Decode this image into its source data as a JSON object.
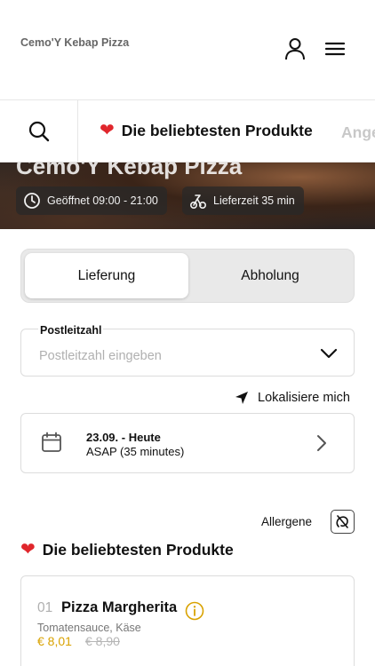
{
  "header": {
    "brand": "Cemo'Y Kebap Pizza",
    "user_icon": "user-icon",
    "menu_icon": "hamburger-menu-icon"
  },
  "category_bar": {
    "search_icon": "search-icon",
    "active_category": "Die beliebtesten Produkte",
    "next_category_partial": "Ange"
  },
  "hero": {
    "title": "Cemo'Y Kebap Pizza",
    "open_hours": "Geöffnet 09:00 - 21:00",
    "delivery_time": "Lieferzeit 35 min"
  },
  "order_mode": {
    "options": [
      "Lieferung",
      "Abholung"
    ],
    "selected": "Lieferung"
  },
  "postcode": {
    "label": "Postleitzahl",
    "placeholder": "Postleitzahl eingeben",
    "value": ""
  },
  "locate": {
    "label": "Lokalisiere mich"
  },
  "schedule": {
    "date_label": "23.09. - Heute",
    "time_label": "ASAP (35 minutes)"
  },
  "allergens": {
    "label": "Allergene"
  },
  "section": {
    "title": "Die beliebtesten Produkte"
  },
  "products": [
    {
      "number": "01",
      "name": "Pizza Margherita",
      "description": "Tomatensauce, Käse",
      "price": "€ 8,01",
      "old_price": "€ 8,90"
    }
  ],
  "colors": {
    "heart": "#e0262c",
    "price": "#d9a200",
    "muted": "#b0b0b0",
    "border": "#dcdcdc",
    "toggle_bg": "#e9e9e9"
  }
}
